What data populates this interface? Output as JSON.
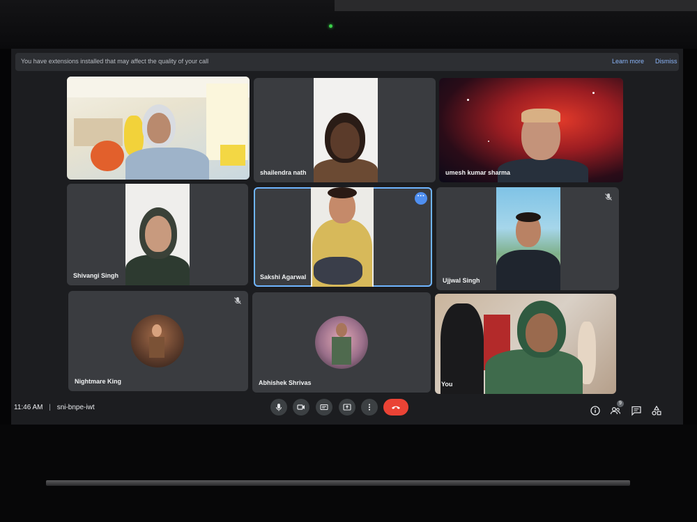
{
  "banner": {
    "message": "You have extensions installed that may affect the quality of your call",
    "learn_more": "Learn more",
    "dismiss": "Dismiss"
  },
  "participants": [
    {
      "name": "",
      "muted": false
    },
    {
      "name": "shailendra nath",
      "muted": false
    },
    {
      "name": "umesh kumar sharma",
      "muted": false
    },
    {
      "name": "Shivangi Singh",
      "muted": false
    },
    {
      "name": "Sakshi Agarwal",
      "muted": false,
      "active_speaker": true
    },
    {
      "name": "Ujjwal Singh",
      "muted": true
    },
    {
      "name": "Nightmare King",
      "muted": true
    },
    {
      "name": "Abhishek Shrivas",
      "muted": false
    },
    {
      "name": "You",
      "muted": false
    }
  ],
  "meeting": {
    "time": "11:46 AM",
    "separator": "|",
    "code": "sni-bnpe-iwt"
  },
  "controls": [
    "mic-icon",
    "camera-icon",
    "captions-icon",
    "present-icon",
    "more-options-icon",
    "end-call-icon"
  ],
  "side_controls": {
    "people_count": "9",
    "icons": [
      "info-icon",
      "people-icon",
      "chat-icon",
      "activities-icon"
    ]
  },
  "colors": {
    "screen_bg": "#1c1d20",
    "tile_bg": "#3a3c40",
    "active_outline": "#6fb5ff",
    "end_call": "#ea4335",
    "link": "#8ab4f8"
  }
}
